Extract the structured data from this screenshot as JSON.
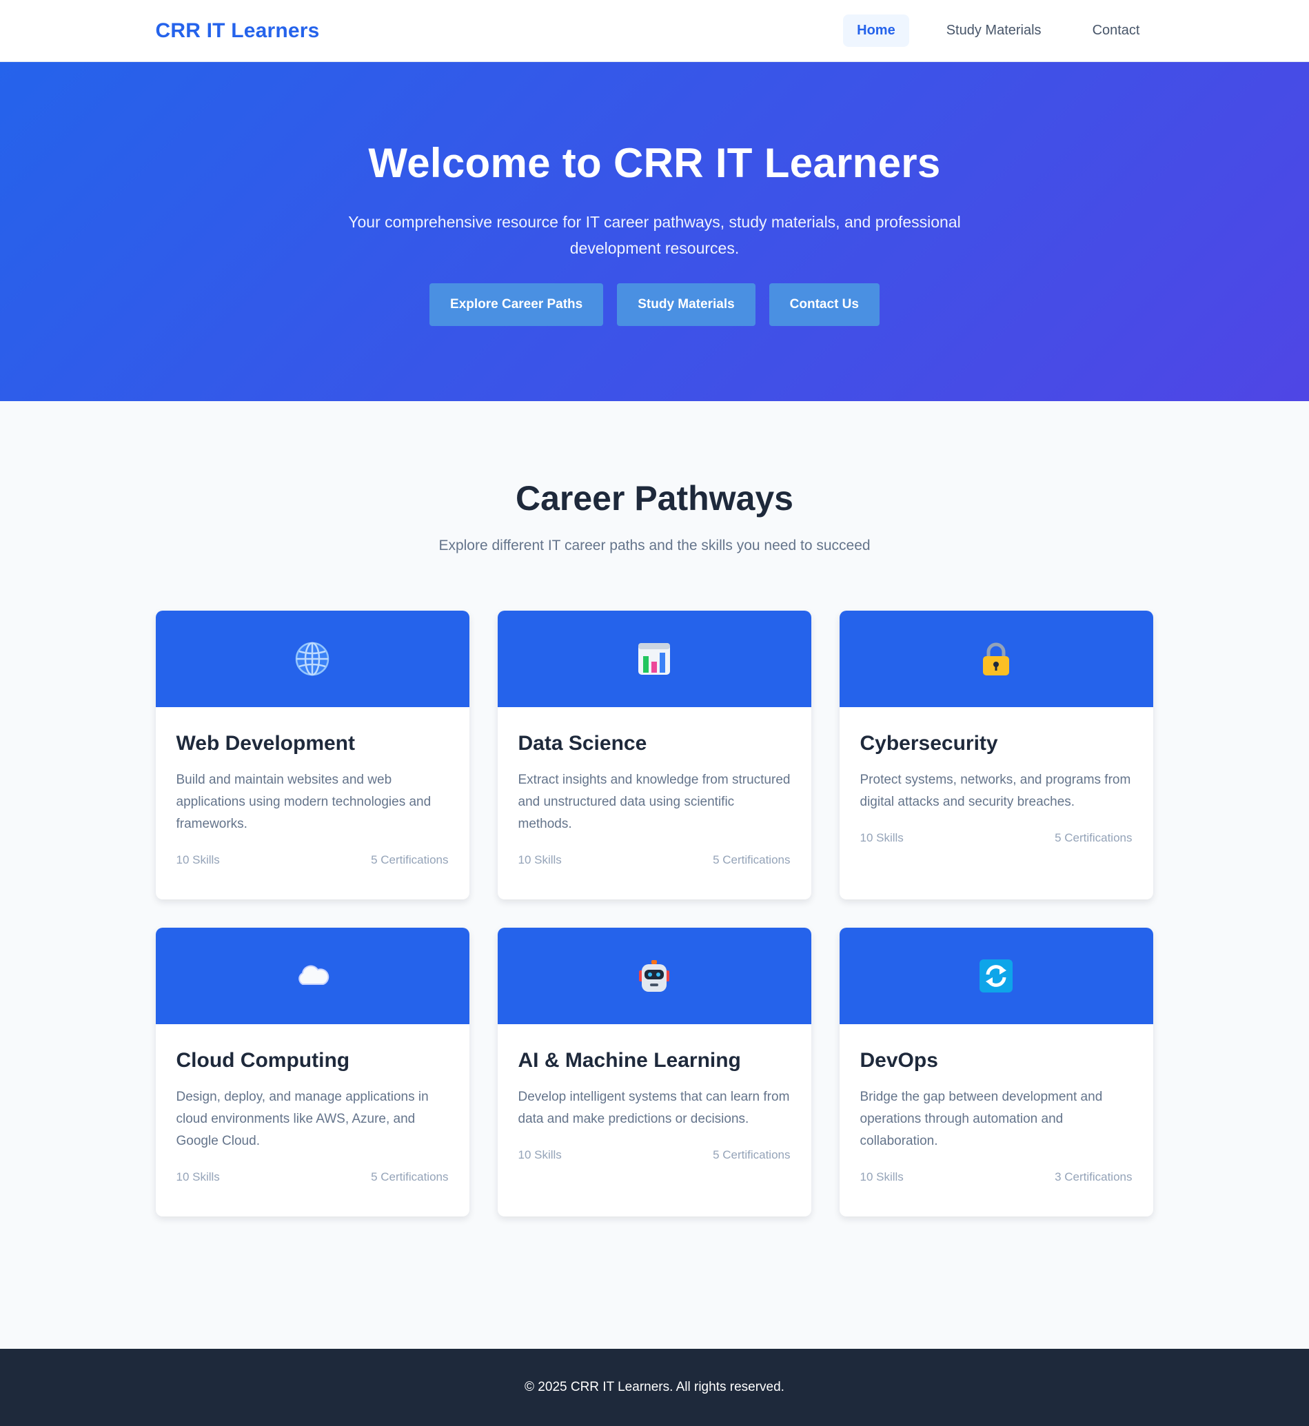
{
  "nav": {
    "brand": "CRR IT Learners",
    "links": [
      {
        "label": "Home",
        "active": true
      },
      {
        "label": "Study Materials",
        "active": false
      },
      {
        "label": "Contact",
        "active": false
      }
    ]
  },
  "hero": {
    "title": "Welcome to CRR IT Learners",
    "subtitle": "Your comprehensive resource for IT career pathways, study materials, and professional development resources.",
    "buttons": [
      "Explore Career Paths",
      "Study Materials",
      "Contact Us"
    ]
  },
  "careers": {
    "title": "Career Pathways",
    "subtitle": "Explore different IT career paths and the skills you need to succeed",
    "cards": [
      {
        "icon": "globe-icon",
        "title": "Web Development",
        "description": "Build and maintain websites and web applications using modern technologies and frameworks.",
        "skills": "10 Skills",
        "certifications": "5 Certifications"
      },
      {
        "icon": "bar-chart-icon",
        "title": "Data Science",
        "description": "Extract insights and knowledge from structured and unstructured data using scientific methods.",
        "skills": "10 Skills",
        "certifications": "5 Certifications"
      },
      {
        "icon": "lock-icon",
        "title": "Cybersecurity",
        "description": "Protect systems, networks, and programs from digital attacks and security breaches.",
        "skills": "10 Skills",
        "certifications": "5 Certifications"
      },
      {
        "icon": "cloud-icon",
        "title": "Cloud Computing",
        "description": "Design, deploy, and manage applications in cloud environments like AWS, Azure, and Google Cloud.",
        "skills": "10 Skills",
        "certifications": "5 Certifications"
      },
      {
        "icon": "robot-icon",
        "title": "AI & Machine Learning",
        "description": "Develop intelligent systems that can learn from data and make predictions or decisions.",
        "skills": "10 Skills",
        "certifications": "5 Certifications"
      },
      {
        "icon": "refresh-icon",
        "title": "DevOps",
        "description": "Bridge the gap between development and operations through automation and collaboration.",
        "skills": "10 Skills",
        "certifications": "3 Certifications"
      }
    ]
  },
  "footer": {
    "text": "© 2025 CRR IT Learners. All rights reserved."
  },
  "colors": {
    "primary": "#2563eb",
    "hero_gradient_end": "#4f46e5",
    "hero_button": "#4a90e2",
    "footer_bg": "#1e293b",
    "page_bg": "#f8fafc"
  }
}
